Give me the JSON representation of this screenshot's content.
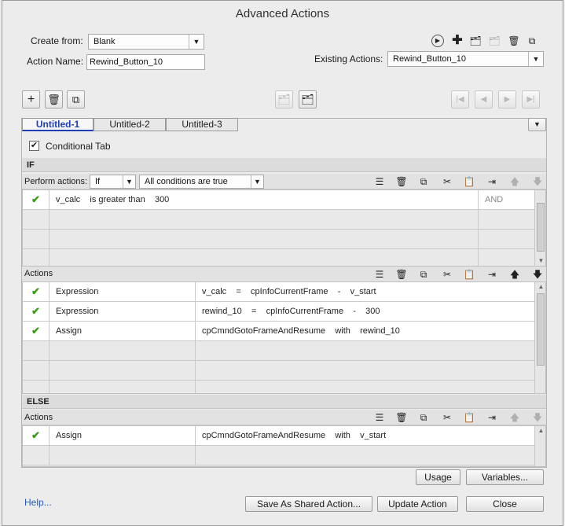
{
  "window": {
    "title": "Advanced Actions"
  },
  "header": {
    "create_from_label": "Create from:",
    "create_from_value": "Blank",
    "action_name_label": "Action Name:",
    "action_name_value": "Rewind_Button_10",
    "existing_actions_label": "Existing Actions:",
    "existing_actions_value": "Rewind_Button_10"
  },
  "tabs": [
    {
      "label": "Untitled-1",
      "active": true
    },
    {
      "label": "Untitled-2",
      "active": false
    },
    {
      "label": "Untitled-3",
      "active": false
    }
  ],
  "conditional_tab_label": "Conditional Tab",
  "if_section": {
    "label": "IF",
    "perform_actions_label": "Perform actions:",
    "perform_actions_value": "If",
    "condition_mode_value": "All conditions are true",
    "conditions": [
      {
        "text": "v_calc    is greater than    300",
        "operator": "AND",
        "checked": true
      }
    ]
  },
  "actions_section": {
    "label": "Actions",
    "rows": [
      {
        "type": "Expression",
        "statement": "v_calc    =    cpInfoCurrentFrame    -    v_start",
        "checked": true
      },
      {
        "type": "Expression",
        "statement": "rewind_10    =    cpInfoCurrentFrame    -    300",
        "checked": true
      },
      {
        "type": "Assign",
        "statement": "cpCmndGotoFrameAndResume    with    rewind_10",
        "checked": true
      }
    ]
  },
  "else_section": {
    "label": "ELSE",
    "actions_label": "Actions",
    "rows": [
      {
        "type": "Assign",
        "statement": "cpCmndGotoFrameAndResume    with    v_start",
        "checked": true
      }
    ]
  },
  "footer": {
    "help_label": "Help...",
    "usage_label": "Usage",
    "variables_label": "Variables...",
    "save_shared_label": "Save As Shared Action...",
    "update_label": "Update Action",
    "close_label": "Close"
  }
}
